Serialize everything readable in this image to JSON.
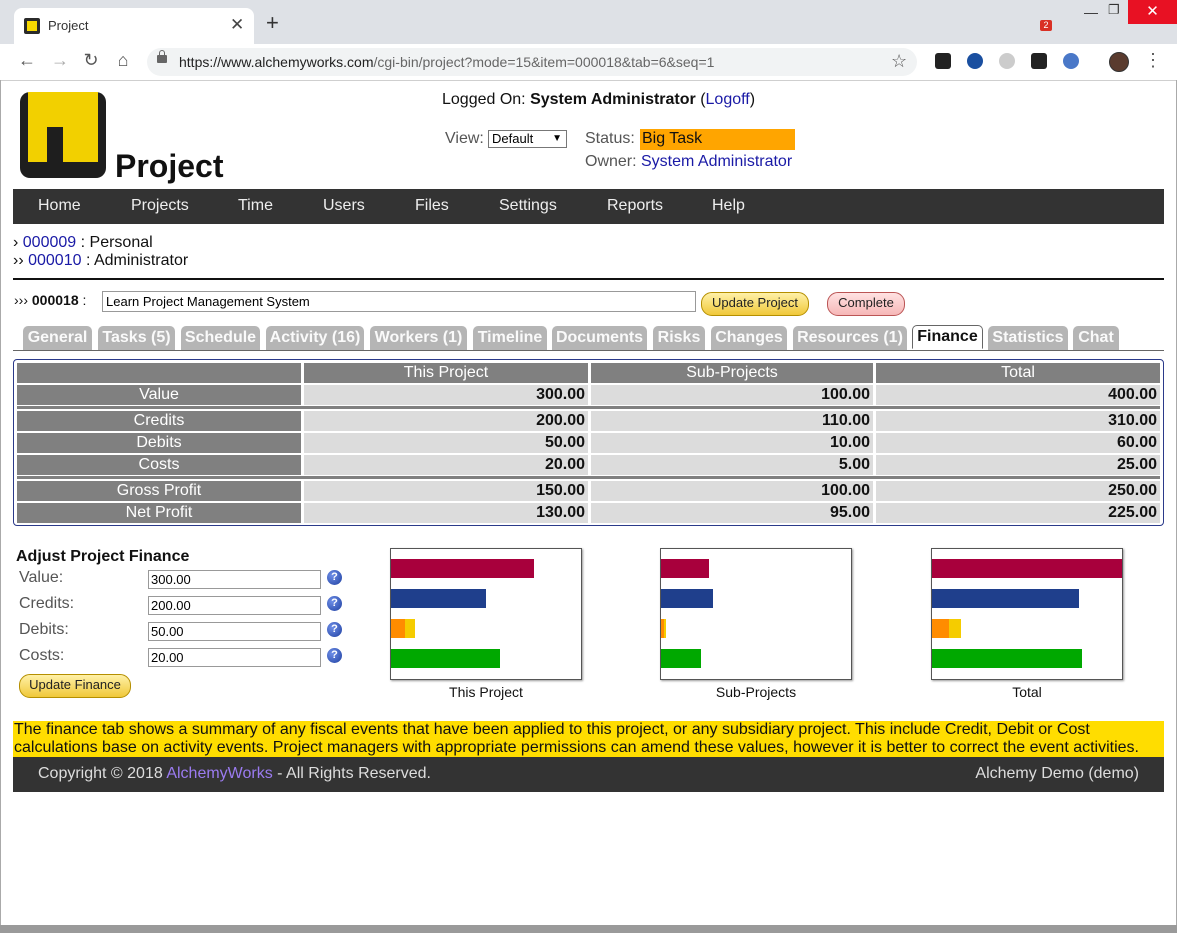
{
  "browser": {
    "tab_title": "Project",
    "url_host": "https://www.alchemyworks.com",
    "url_path": "/cgi-bin/project?mode=15&item=000018&tab=6&seq=1",
    "ext_badge": "2"
  },
  "header": {
    "app_title": "Project",
    "logged_on_label": "Logged On:",
    "user_name": "System Administrator",
    "logoff_link": "Logoff",
    "view_label": "View:",
    "view_value": "Default",
    "status_label": "Status:",
    "status_value": "Big Task",
    "status_color": "#ffa500",
    "owner_label": "Owner:",
    "owner_value": "System Administrator"
  },
  "nav": [
    "Home",
    "Projects",
    "Time",
    "Users",
    "Files",
    "Settings",
    "Reports",
    "Help"
  ],
  "breadcrumb": [
    {
      "prefix": "›",
      "id": "000009",
      "name": "Personal"
    },
    {
      "prefix": "››",
      "id": "000010",
      "name": "Administrator"
    }
  ],
  "project": {
    "prefix": "›››",
    "id": "000018",
    "name": "Learn Project Management System",
    "update_button": "Update Project",
    "complete_button": "Complete"
  },
  "tabs": [
    "General",
    "Tasks (5)",
    "Schedule",
    "Activity (16)",
    "Workers (1)",
    "Timeline",
    "Documents",
    "Risks",
    "Changes",
    "Resources (1)",
    "Finance",
    "Statistics",
    "Chat"
  ],
  "active_tab": "Finance",
  "finance_table": {
    "columns": [
      "This Project",
      "Sub-Projects",
      "Total"
    ],
    "rows": [
      {
        "label": "Value",
        "values": [
          "300.00",
          "100.00",
          "400.00"
        ]
      },
      {
        "label": "Credits",
        "values": [
          "200.00",
          "110.00",
          "310.00"
        ]
      },
      {
        "label": "Debits",
        "values": [
          "50.00",
          "10.00",
          "60.00"
        ]
      },
      {
        "label": "Costs",
        "values": [
          "20.00",
          "5.00",
          "25.00"
        ]
      },
      {
        "label": "Gross Profit",
        "values": [
          "150.00",
          "100.00",
          "250.00"
        ]
      },
      {
        "label": "Net Profit",
        "values": [
          "130.00",
          "95.00",
          "225.00"
        ]
      }
    ]
  },
  "adjust": {
    "title": "Adjust Project Finance",
    "fields": [
      {
        "label": "Value:",
        "value": "300.00"
      },
      {
        "label": "Credits:",
        "value": "200.00"
      },
      {
        "label": "Debits:",
        "value": "50.00"
      },
      {
        "label": "Costs:",
        "value": "20.00"
      }
    ],
    "help_glyph": "?",
    "button": "Update Finance"
  },
  "chart_data": [
    {
      "type": "bar",
      "title": "This Project",
      "categories": [
        "Value",
        "Credits",
        "Debits",
        "Costs"
      ],
      "values": [
        300,
        200,
        50,
        20
      ],
      "xlim": [
        0,
        400
      ],
      "colors": [
        "#a8003c",
        "#1f3f8c",
        "#ff8c00",
        "#f5cc00",
        "#00a800"
      ]
    },
    {
      "type": "bar",
      "title": "Sub-Projects",
      "categories": [
        "Value",
        "Credits",
        "Debits",
        "Costs"
      ],
      "values": [
        100,
        110,
        10,
        5
      ],
      "xlim": [
        0,
        400
      ],
      "colors": [
        "#a8003c",
        "#1f3f8c",
        "#ff8c00",
        "#f5cc00",
        "#00a800"
      ]
    },
    {
      "type": "bar",
      "title": "Total",
      "categories": [
        "Value",
        "Credits",
        "Debits",
        "Costs"
      ],
      "values": [
        400,
        310,
        60,
        25
      ],
      "xlim": [
        0,
        400
      ],
      "colors": [
        "#a8003c",
        "#1f3f8c",
        "#ff8c00",
        "#f5cc00",
        "#00a800"
      ]
    }
  ],
  "note": "The finance tab shows a summary of any fiscal events that have been applied to this project, or any subsidiary project. This include Credit, Debit or Cost calculations base on activity events. Project managers with appropriate permissions can amend these values, however it is better to correct the event activities.",
  "footer": {
    "copyright": "Copyright © 2018",
    "brand": "AlchemyWorks",
    "rights": "- All Rights Reserved.",
    "right_text": "Alchemy Demo (demo)"
  }
}
